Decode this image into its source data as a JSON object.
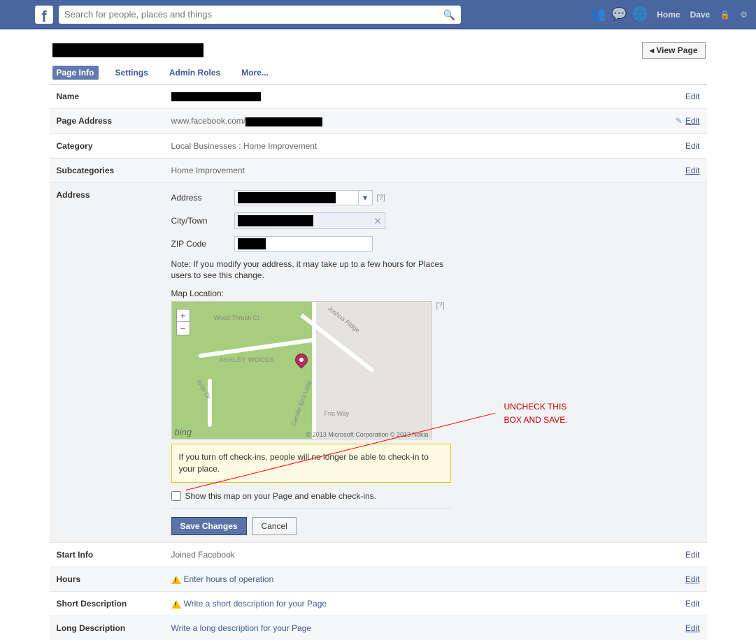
{
  "topbar": {
    "search_placeholder": "Search for people, places and things",
    "nav_home": "Home",
    "nav_user": "Dave"
  },
  "header": {
    "view_page": "View Page"
  },
  "tabs": {
    "page_info": "Page Info",
    "settings": "Settings",
    "admin_roles": "Admin Roles",
    "more": "More..."
  },
  "rows": {
    "name_label": "Name",
    "page_address_label": "Page Address",
    "page_address_prefix": "www.facebook.com/",
    "category_label": "Category",
    "category_value": "Local Businesses : Home Improvement",
    "subcategories_label": "Subcategories",
    "subcategories_value": "Home Improvement",
    "address_label": "Address",
    "start_info_label": "Start Info",
    "start_info_value": "Joined Facebook",
    "hours_label": "Hours",
    "hours_link": "Enter hours of operation",
    "short_desc_label": "Short Description",
    "short_desc_link": "Write a short description for your Page",
    "long_desc_label": "Long Description",
    "long_desc_link": "Write a long description for your Page",
    "edit": "Edit"
  },
  "address_form": {
    "address_lbl": "Address",
    "city_lbl": "City/Town",
    "zip_lbl": "ZIP Code",
    "help": "[?]",
    "note": "Note: If you modify your address, it may take up to a few hours for Places users to see this change.",
    "map_location_lbl": "Map Location:",
    "map_attrib": "© 2013 Microsoft Corporation   © 2013 Nokia",
    "map_name": "ASHLEY WOODS",
    "road1": "Wood Thrush Ct",
    "road2": "Joshua Ridge",
    "road3": "Frio Way",
    "road4": "Aron Dr",
    "road5": "Candle Bird Loop",
    "map_logo": "bing",
    "yellow_msg": "If you turn off check-ins, people will no longer be able to check-in to your place.",
    "checkbox_label": "Show this map on your Page and enable check-ins.",
    "save": "Save Changes",
    "cancel": "Cancel"
  },
  "annotation": {
    "text1": "UNCHECK THIS",
    "text2": "BOX AND SAVE."
  }
}
